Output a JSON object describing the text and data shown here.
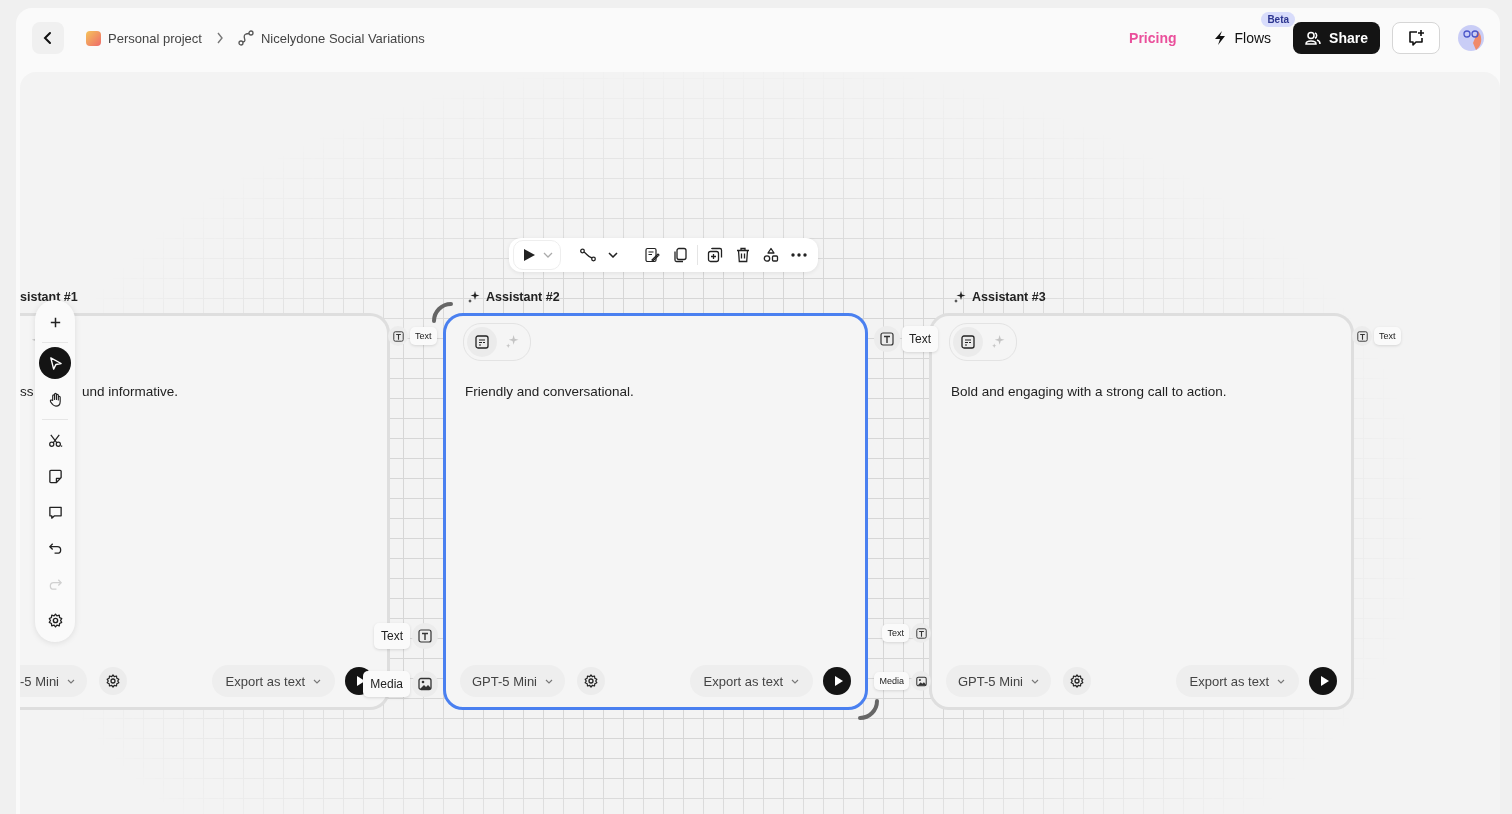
{
  "topbar": {
    "breadcrumb": [
      {
        "label": "Personal project",
        "kind": "project"
      },
      {
        "label": "Nicelydone Social Variations",
        "kind": "flow"
      }
    ],
    "pricing": "Pricing",
    "flows": {
      "label": "Flows",
      "badge": "Beta"
    },
    "share": "Share"
  },
  "tools": [
    {
      "kind": "add",
      "selected": false,
      "disabled": false
    },
    {
      "kind": "select",
      "selected": true,
      "disabled": false
    },
    {
      "kind": "hand",
      "selected": false,
      "disabled": false
    },
    {
      "kind": "cut",
      "selected": false,
      "disabled": false
    },
    {
      "kind": "note",
      "selected": false,
      "disabled": false
    },
    {
      "kind": "comment",
      "selected": false,
      "disabled": false
    },
    {
      "kind": "undo",
      "selected": false,
      "disabled": false
    },
    {
      "kind": "redo",
      "selected": false,
      "disabled": true
    },
    {
      "kind": "settings",
      "selected": false,
      "disabled": false
    }
  ],
  "cards": [
    {
      "kind": "partial",
      "title": "sistant #1",
      "description_lead": "ss",
      "description": "und informative.",
      "model": "-5 Mini",
      "export": "Export as text",
      "selected": false,
      "outputs": [
        {
          "label": "Text",
          "kind": "text"
        }
      ]
    },
    {
      "kind": "full",
      "title": "Assistant #2",
      "description": "Friendly and conversational.",
      "model": "GPT-5 Mini",
      "export": "Export as text",
      "selected": true,
      "inputs": [
        {
          "label": "Text",
          "kind": "text"
        },
        {
          "label": "Media",
          "kind": "media"
        }
      ],
      "outputs": [
        {
          "label": "Text",
          "kind": "text"
        }
      ]
    },
    {
      "kind": "full",
      "title": "Assistant #3",
      "description": "Bold and engaging with a strong call to action.",
      "model": "GPT-5 Mini",
      "export": "Export as text",
      "selected": false,
      "inputs": [
        {
          "label": "Text",
          "kind": "text"
        },
        {
          "label": "Media",
          "kind": "media"
        }
      ],
      "outputs": [
        {
          "label": "Text",
          "kind": "text"
        }
      ]
    }
  ]
}
